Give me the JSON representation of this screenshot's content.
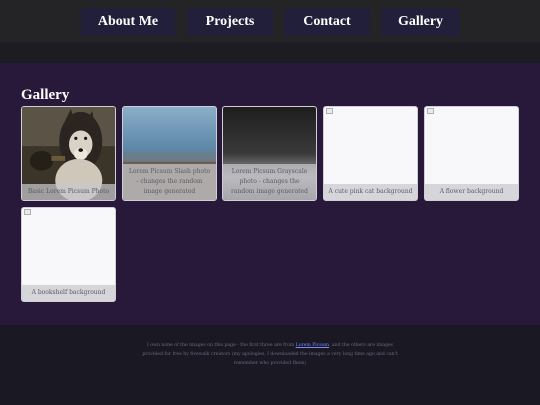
{
  "nav": {
    "items": [
      {
        "label": "About Me"
      },
      {
        "label": "Projects"
      },
      {
        "label": "Contact"
      },
      {
        "label": "Gallery"
      }
    ]
  },
  "gallery": {
    "title": "Gallery",
    "cards": [
      {
        "caption": "Basic Lorem Picsum Photo"
      },
      {
        "caption": "Lorem Picsum Slash photo - changes the random image generated"
      },
      {
        "caption": "Lorem Picsum Grayscale photo - changes the random image generated"
      },
      {
        "caption": "A cute pink cat background"
      },
      {
        "caption": "A flower background"
      },
      {
        "caption": "A bookshelf background"
      }
    ]
  },
  "footer": {
    "text_before": "I own none of the images on this page - the first three are from ",
    "link_label": "Lorem Picsum",
    "text_after": ", and the others are images provided for free by fivewalk creators (my apologies, I downloaded the images a very long time ago and can't remember who provided them)"
  },
  "colors": {
    "page_bg": "#191823",
    "topbar": "#242326",
    "nav_button": "#211f3a",
    "main_bg": "#28193a",
    "link": "#7b8cff"
  }
}
